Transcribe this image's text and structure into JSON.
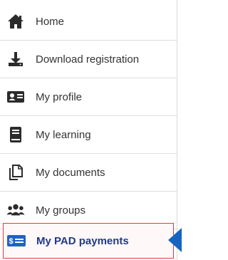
{
  "menu": {
    "items": [
      {
        "label": "Home",
        "icon": "home-icon"
      },
      {
        "label": "Download registration",
        "icon": "download-icon"
      },
      {
        "label": "My profile",
        "icon": "id-card-icon"
      },
      {
        "label": "My learning",
        "icon": "book-icon"
      },
      {
        "label": "My documents",
        "icon": "documents-icon"
      },
      {
        "label": "My groups",
        "icon": "users-icon"
      },
      {
        "label": "My PAD payments",
        "icon": "payment-icon",
        "active": true
      }
    ]
  },
  "colors": {
    "active_label": "#1f3a8a",
    "active_border": "#e03b3b",
    "active_pointer": "#1565c0",
    "icon": "#2b2b2b",
    "payment_icon": "#1e63c4"
  }
}
